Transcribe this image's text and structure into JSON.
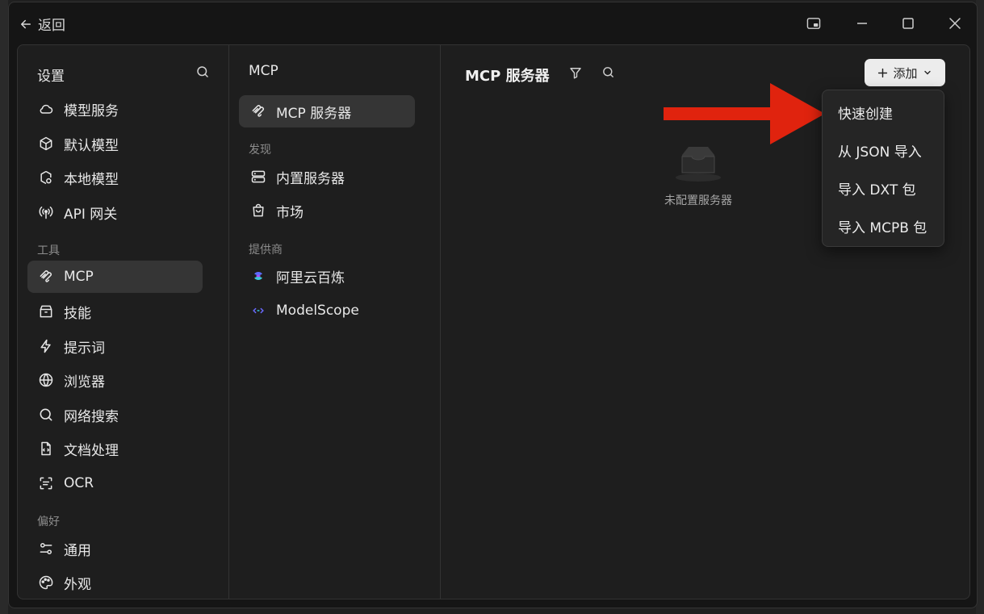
{
  "titlebar": {
    "back_label": "返回"
  },
  "sidebar": {
    "title": "设置",
    "groups": [
      {
        "label": "",
        "items": [
          {
            "label": "模型服务",
            "icon": "cloud-icon"
          },
          {
            "label": "默认模型",
            "icon": "cube-icon"
          },
          {
            "label": "本地模型",
            "icon": "local-model-icon"
          },
          {
            "label": "API 网关",
            "icon": "antenna-icon"
          }
        ]
      },
      {
        "label": "工具",
        "items": [
          {
            "label": "MCP",
            "icon": "mcp-icon",
            "active": true
          },
          {
            "label": "技能",
            "icon": "skill-icon"
          },
          {
            "label": "提示词",
            "icon": "lightning-icon"
          },
          {
            "label": "浏览器",
            "icon": "globe-icon"
          },
          {
            "label": "网络搜索",
            "icon": "search-icon"
          },
          {
            "label": "文档处理",
            "icon": "document-icon"
          },
          {
            "label": "OCR",
            "icon": "scan-icon"
          }
        ]
      },
      {
        "label": "偏好",
        "items": [
          {
            "label": "通用",
            "icon": "sliders-icon"
          },
          {
            "label": "外观",
            "icon": "palette-icon"
          }
        ]
      }
    ]
  },
  "mcp_nav": {
    "title": "MCP",
    "servers_label": "MCP 服务器",
    "discover_label": "发现",
    "discover_items": [
      "内置服务器",
      "市场"
    ],
    "providers_label": "提供商",
    "providers": [
      "阿里云百炼",
      "ModelScope"
    ]
  },
  "main": {
    "title": "MCP 服务器",
    "add_label": "添加",
    "empty_label": "未配置服务器"
  },
  "add_menu": {
    "items": [
      "快速创建",
      "从 JSON 导入",
      "导入 DXT 包",
      "导入 MCPB 包"
    ]
  },
  "colors": {
    "accent_arrow": "#e0230e",
    "active_bg": "#353535",
    "add_button_bg": "#ececec"
  }
}
